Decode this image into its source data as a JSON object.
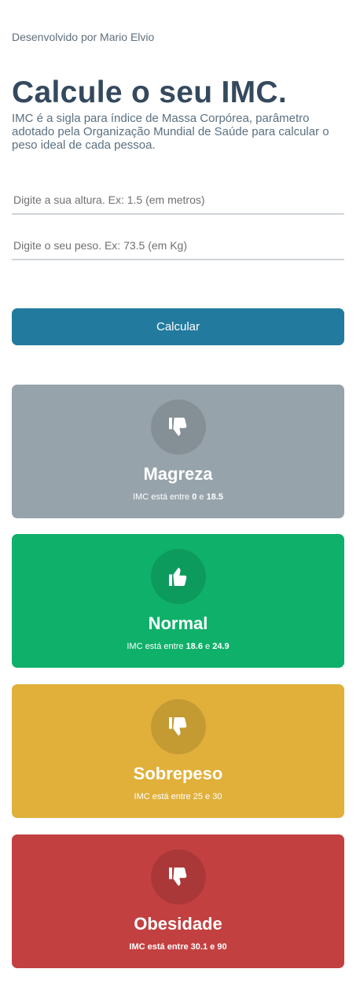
{
  "header": {
    "credit": "Desenvolvido por Mario Elvio",
    "title": "Calcule o seu IMC.",
    "description": "IMC é a sigla para índice de Massa Corpórea, parâmetro adotado pela Organização Mundial de Saúde para calcular o peso ideal de cada pessoa."
  },
  "form": {
    "height_placeholder": "Digite a sua altura. Ex: 1.5 (em metros)",
    "height_value": "",
    "weight_placeholder": "Digite o seu peso. Ex: 73.5 (em Kg)",
    "weight_value": "",
    "calculate_label": "Calcular"
  },
  "categories": [
    {
      "name": "Magreza",
      "range_prefix": "IMC está entre",
      "min": "0",
      "connector": "e",
      "max": "18.5",
      "icon": "thumbs-down-icon",
      "color": "#97a3ab"
    },
    {
      "name": "Normal",
      "range_prefix": "IMC está entre",
      "min": "18.6",
      "connector": "e",
      "max": "24.9",
      "icon": "thumbs-up-icon",
      "color": "#0fb06a"
    },
    {
      "name": "Sobrepeso",
      "range_prefix": "IMC está entre",
      "min": "25",
      "connector": "e",
      "max": "30",
      "icon": "thumbs-down-icon",
      "color": "#e0b03b"
    },
    {
      "name": "Obesidade",
      "range_prefix": "IMC está entre",
      "min": "30.1",
      "connector": "e",
      "max": "90",
      "icon": "thumbs-down-icon",
      "color": "#c34041"
    }
  ]
}
